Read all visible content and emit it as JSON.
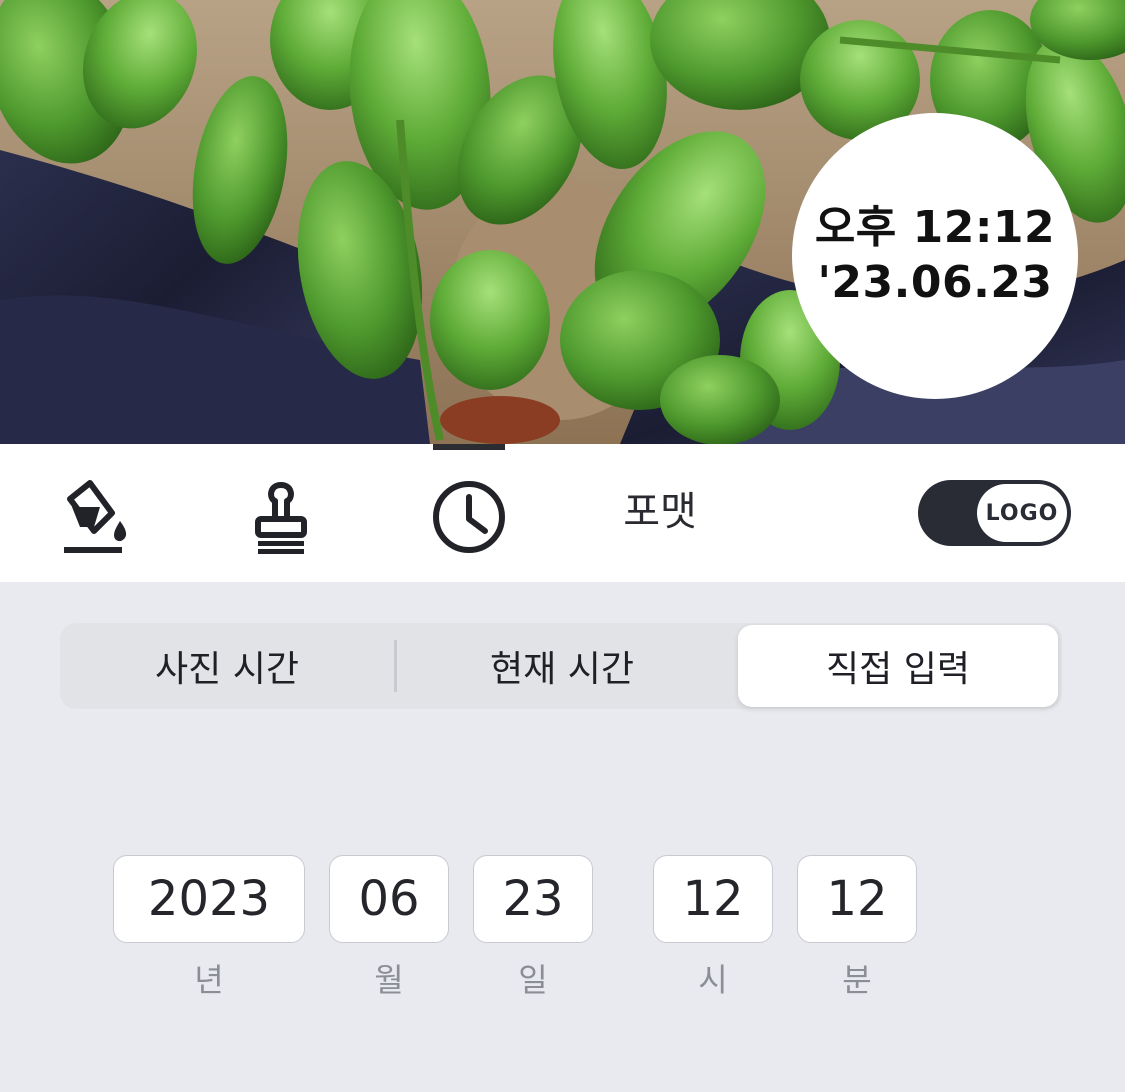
{
  "preview": {
    "stamp_time": "오후 12:12",
    "stamp_date": "'23.06.23"
  },
  "toolbar": {
    "tools": [
      {
        "icon": "paint-bucket-icon"
      },
      {
        "icon": "stamp-icon"
      },
      {
        "icon": "clock-icon",
        "active": true
      }
    ],
    "format_label": "포맷",
    "logo_toggle_label": "LOGO",
    "logo_toggle_on": true
  },
  "time_source": {
    "options": [
      "사진 시간",
      "현재 시간",
      "직접 입력"
    ],
    "selected": "직접 입력"
  },
  "datetime": {
    "year": "2023",
    "month": "06",
    "day": "23",
    "hour": "12",
    "minute": "12",
    "units": {
      "year": "년",
      "month": "월",
      "day": "일",
      "hour": "시",
      "minute": "분"
    }
  },
  "colors": {
    "accent_dark": "#2a2c35",
    "panel_bg": "#e9eaef",
    "stamp_bg": "#ffffff"
  }
}
